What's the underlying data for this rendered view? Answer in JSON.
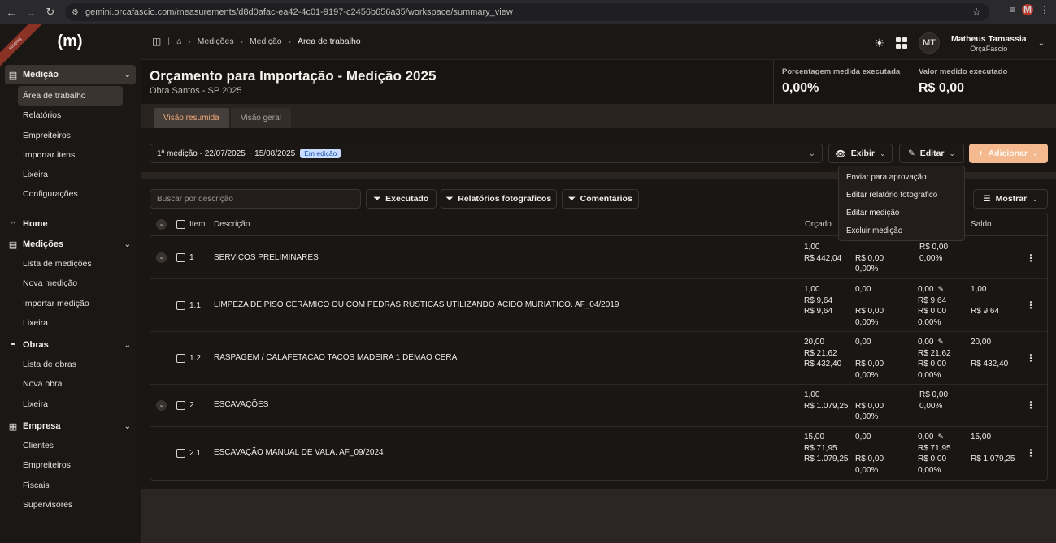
{
  "browser": {
    "url": "gemini.orcafascio.com/measurements/d8d0afac-ea42-4c01-9197-c2456b656a35/workspace/summary_view",
    "profile_initial": "M"
  },
  "sidebar": {
    "ribbon": "staging",
    "logo": "(m)",
    "groups": [
      {
        "label": "Medição",
        "icon": "clipboard-icon",
        "items": [
          "Área de trabalho",
          "Relatórios",
          "Empreiteiros",
          "Importar itens",
          "Lixeira",
          "Configurações"
        ]
      },
      {
        "label": "Home",
        "icon": "home-icon",
        "items": []
      },
      {
        "label": "Medições",
        "icon": "clipboard-icon",
        "items": [
          "Lista de medições",
          "Nova medição",
          "Importar medição",
          "Lixeira"
        ]
      },
      {
        "label": "Obras",
        "icon": "helmet-icon",
        "items": [
          "Lista de obras",
          "Nova obra",
          "Lixeira"
        ]
      },
      {
        "label": "Empresa",
        "icon": "building-icon",
        "items": [
          "Clientes",
          "Empreiteiros",
          "Fiscais",
          "Supervisores"
        ]
      }
    ]
  },
  "header": {
    "breadcrumbs": [
      "Medições",
      "Medição",
      "Área de trabalho"
    ],
    "user_initials": "MT",
    "user_name": "Matheus Tamassia",
    "user_org": "OrçaFascio"
  },
  "page": {
    "title": "Orçamento para Importação - Medição 2025",
    "subtitle": "Obra Santos - SP 2025",
    "kpi_percent_label": "Porcentagem medida executada",
    "kpi_percent_value": "0,00%",
    "kpi_value_label": "Valor medido executado",
    "kpi_value_value": "R$ 0,00"
  },
  "tabs": [
    "Visão resumida",
    "Visão geral"
  ],
  "toolbar": {
    "measurement": "1ª medição - 22/07/2025 ~ 15/08/2025",
    "status_badge": "Em edição",
    "show_label": "Exibir",
    "edit_label": "Editar",
    "add_label": "Adicionar"
  },
  "edit_menu": [
    "Enviar para aprovação",
    "Editar relatório fotografico",
    "Editar medição",
    "Excluir medição"
  ],
  "filters": {
    "search_placeholder": "Buscar por descrição",
    "executed": "Executado",
    "photo_reports": "Relatórios fotograficos",
    "comments": "Comentários",
    "show": "Mostrar"
  },
  "table": {
    "headers": {
      "item": "Item",
      "description": "Descrição",
      "budget": "Orçado",
      "balance": "Saldo"
    },
    "rows": [
      {
        "item": "1",
        "desc": "SERVIÇOS PRELIMINARES",
        "budget": [
          "1,00",
          "R$ 442,04"
        ],
        "col2": [
          "",
          "R$ 0,00",
          "0,00%"
        ],
        "col3": [
          "R$ 0,00",
          "0,00%"
        ],
        "balance": []
      },
      {
        "item": "1.1",
        "desc": "LIMPEZA DE PISO CERÂMICO OU COM PEDRAS RÚSTICAS UTILIZANDO ÁCIDO MURIÁTICO. AF_04/2019",
        "budget": [
          "1,00",
          "R$ 9,64",
          "R$ 9,64"
        ],
        "col2": [
          "0,00",
          "",
          "R$ 0,00",
          "0,00%"
        ],
        "col3": [
          "0,00",
          "R$ 9,64",
          "R$ 0,00",
          "0,00%"
        ],
        "balance": [
          "1,00",
          "",
          "R$ 9,64"
        ]
      },
      {
        "item": "1.2",
        "desc": "RASPAGEM / CALAFETACAO TACOS MADEIRA 1 DEMAO CERA",
        "budget": [
          "20,00",
          "R$ 21,62",
          "R$ 432,40"
        ],
        "col2": [
          "0,00",
          "",
          "R$ 0,00",
          "0,00%"
        ],
        "col3": [
          "0,00",
          "R$ 21,62",
          "R$ 0,00",
          "0,00%"
        ],
        "balance": [
          "20,00",
          "",
          "R$ 432,40"
        ]
      },
      {
        "item": "2",
        "desc": "ESCAVAÇÕES",
        "budget": [
          "1,00",
          "R$ 1.079,25"
        ],
        "col2": [
          "",
          "R$ 0,00",
          "0,00%"
        ],
        "col3": [
          "R$ 0,00",
          "0,00%"
        ],
        "balance": []
      },
      {
        "item": "2.1",
        "desc": "ESCAVAÇÃO MANUAL DE VALA. AF_09/2024",
        "budget": [
          "15,00",
          "R$ 71,95",
          "R$ 1.079,25"
        ],
        "col2": [
          "0,00",
          "",
          "R$ 0,00",
          "0,00%"
        ],
        "col3": [
          "0,00",
          "R$ 71,95",
          "R$ 0,00",
          "0,00%"
        ],
        "balance": [
          "15,00",
          "",
          "R$ 1.079,25"
        ]
      }
    ]
  }
}
